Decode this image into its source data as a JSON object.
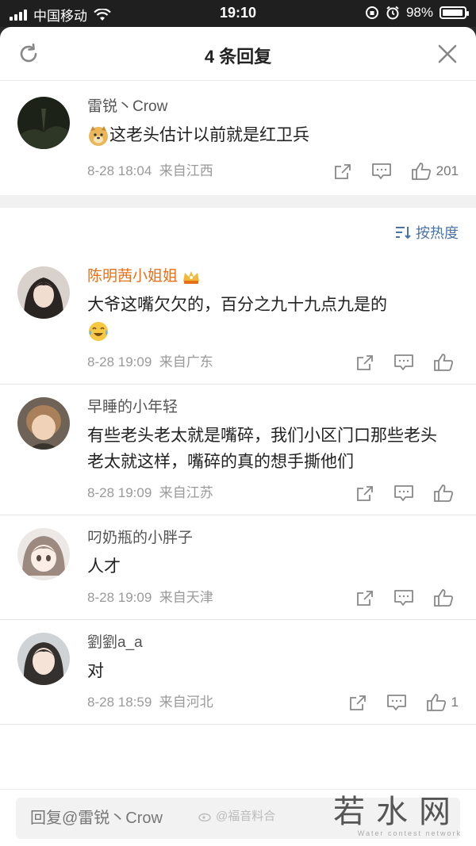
{
  "status_bar": {
    "carrier": "中国移动",
    "time": "19:10",
    "battery": "98%",
    "battery_level": 0.98
  },
  "header": {
    "title": "4 条回复",
    "refresh_icon": "refresh-icon",
    "close_icon": "close-icon"
  },
  "top_comment": {
    "name": "雷锐丶Crow",
    "text": "这老头估计以前就是红卫兵",
    "time": "8-28 18:04",
    "source": "来自江西",
    "likes": "201"
  },
  "sort": {
    "label": "按热度"
  },
  "replies": [
    {
      "name": "陈明茜小姐姐",
      "text": "大爷这嘴欠欠的，百分之九十九点九是的",
      "time": "8-28 19:09",
      "source": "来自广东",
      "likes": ""
    },
    {
      "name": "早睡的小年轻",
      "text": "有些老头老太就是嘴碎，我们小区门口那些老头老太就这样，嘴碎的真的想手撕他们",
      "time": "8-28 19:09",
      "source": "来自江苏",
      "likes": ""
    },
    {
      "name": "叼奶瓶的小胖子",
      "text": "人才",
      "time": "8-28 19:09",
      "source": "来自天津",
      "likes": ""
    },
    {
      "name": "劉劉a_a",
      "text": "对",
      "time": "8-28 18:59",
      "source": "来自河北",
      "likes": "1"
    }
  ],
  "bottom": {
    "reply_placeholder": "回复@雷锐丶Crow",
    "watermark": "若水网",
    "watermark_sub": "Water contest network",
    "weibo_mark": "@福音料合"
  },
  "colors": {
    "vip_name": "#e8701b",
    "link_blue": "#4a73a8",
    "meta_gray": "#9a9a9a"
  }
}
